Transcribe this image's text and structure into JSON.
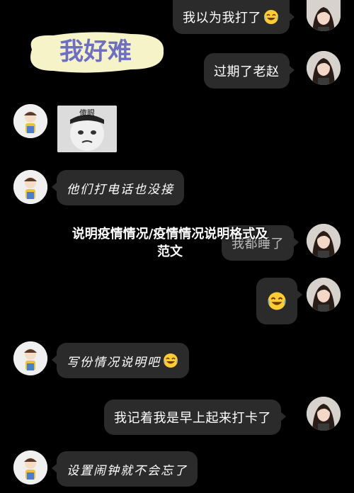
{
  "sticker": {
    "text": "我好难"
  },
  "meme": {
    "caption": "傻眼"
  },
  "messages": [
    {
      "side": "me",
      "text": "我以为我打了",
      "emoji": "laugh-cry"
    },
    {
      "side": "me",
      "text": "过期了老赵"
    },
    {
      "side": "other",
      "type": "meme"
    },
    {
      "side": "other",
      "text": "他们打电话也没接"
    },
    {
      "side": "me",
      "text": "我都睡了"
    },
    {
      "side": "me",
      "emoji": "laugh-cry"
    },
    {
      "side": "other",
      "text": "写份情况说明吧",
      "emoji": "laugh-cry"
    },
    {
      "side": "me",
      "text": "我记着我是早上起来打卡了"
    },
    {
      "side": "other",
      "text": "设置闹钟就不会忘了"
    }
  ],
  "overlay": {
    "title_line1": "说明疫情情况/疫情情况说明格式及",
    "title_line2": "范文"
  },
  "colors": {
    "background": "#000000",
    "bubble": "#2b2b2b",
    "text": "#ffffff",
    "sticker_bg": "#f7f3c8",
    "sticker_text": "#6d6fc5"
  }
}
